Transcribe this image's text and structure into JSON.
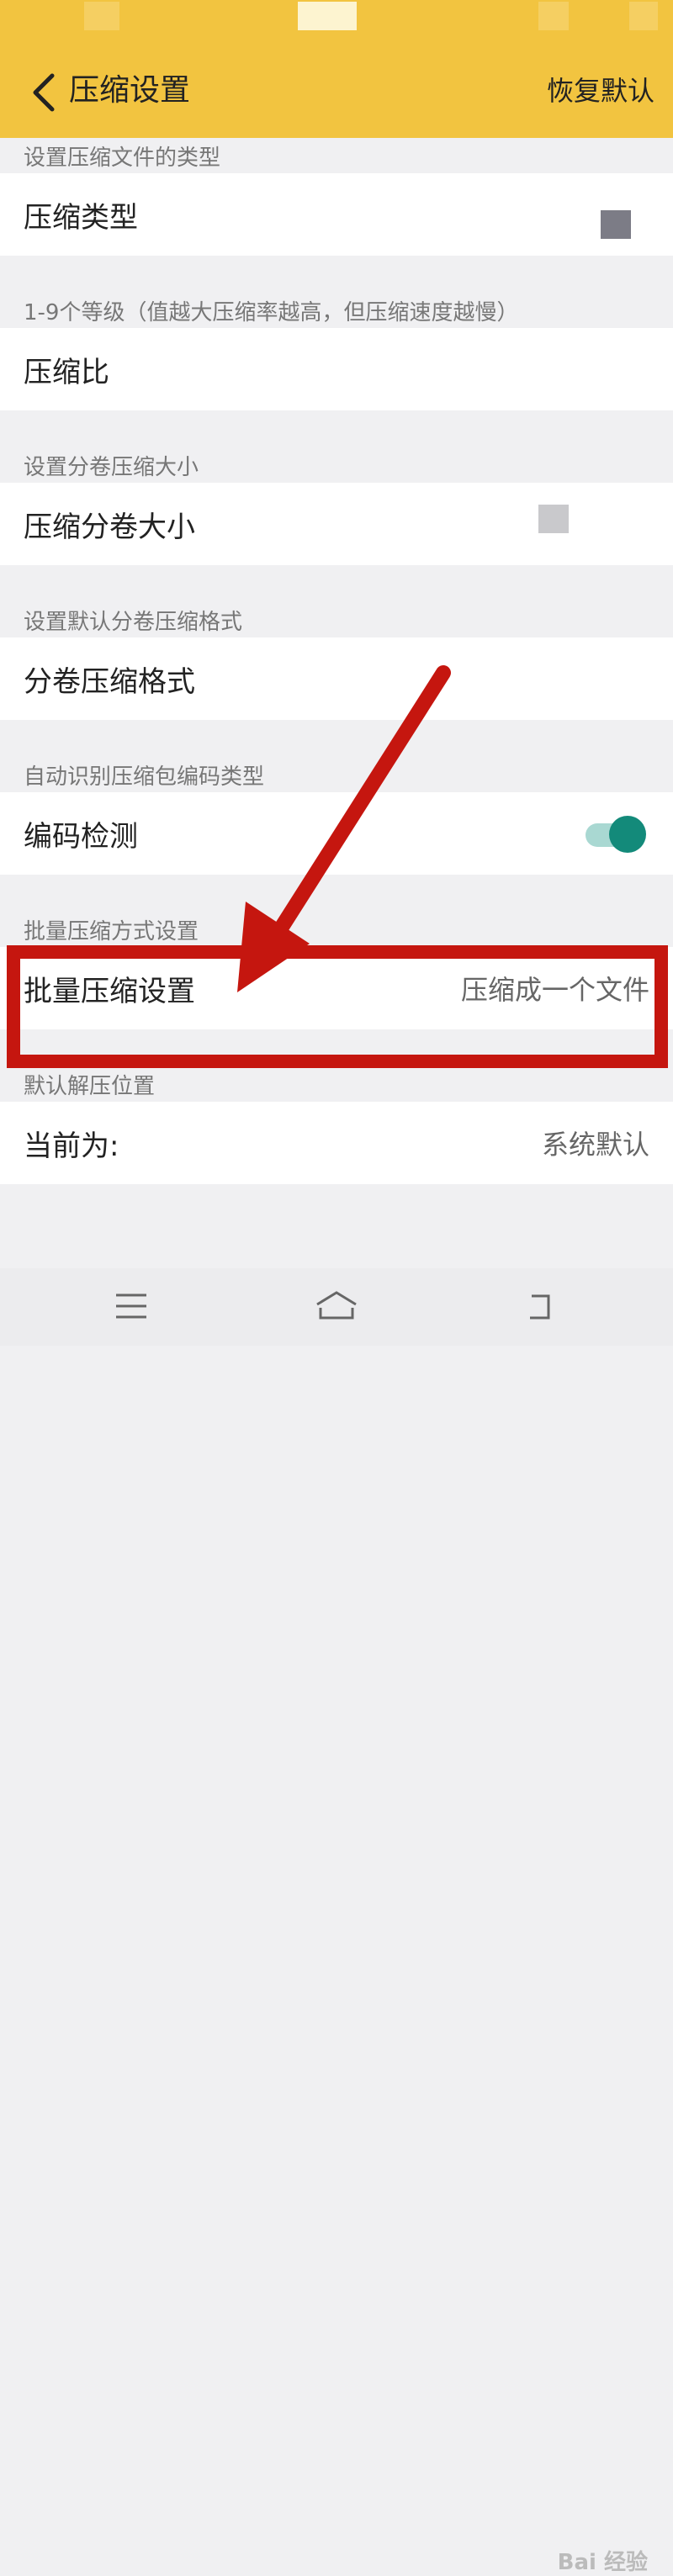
{
  "appbar": {
    "title": "压缩设置",
    "restore_label": "恢复默认"
  },
  "sections": [
    {
      "header": "设置压缩文件的类型",
      "label": "压缩类型",
      "value": ""
    },
    {
      "header": "1-9个等级（值越大压缩率越高，但压缩速度越慢）",
      "label": "压缩比",
      "value": ""
    },
    {
      "header": "设置分卷压缩大小",
      "label": "压缩分卷大小",
      "value": ""
    },
    {
      "header": "设置默认分卷压缩格式",
      "label": "分卷压缩格式",
      "value": ""
    },
    {
      "header": "自动识别压缩包编码类型",
      "label": "编码检测",
      "value": "",
      "toggle_on": true
    },
    {
      "header": "批量压缩方式设置",
      "label": "批量压缩设置",
      "value": "压缩成一个文件"
    },
    {
      "header": "默认解压位置",
      "label": "当前为:",
      "value": "系统默认"
    }
  ],
  "watermark": "Bai 经验",
  "colors": {
    "appbar": "#f2c440",
    "toggle_on": "#138a7a",
    "highlight": "#c5160f"
  }
}
